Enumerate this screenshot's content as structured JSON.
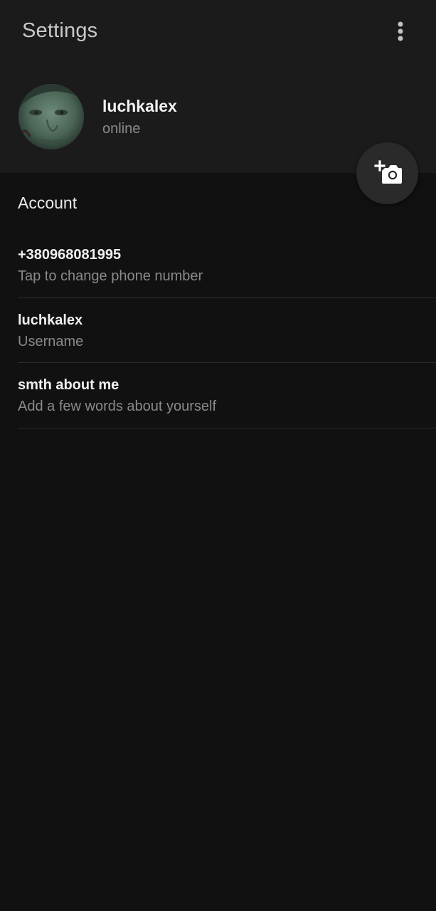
{
  "header": {
    "title": "Settings",
    "menu_icon": "more-vertical-icon"
  },
  "profile": {
    "name": "luchkalex",
    "status": "online",
    "avatar_icon": "avatar-photo",
    "fab_icon": "add-photo-camera-icon"
  },
  "account": {
    "section_title": "Account",
    "rows": [
      {
        "primary": "+380968081995",
        "secondary": "Tap to change phone number"
      },
      {
        "primary": "luchkalex",
        "secondary": "Username"
      },
      {
        "primary": "smth about me",
        "secondary": "Add a few words about yourself"
      }
    ]
  },
  "colors": {
    "background": "#111111",
    "header_background": "#1b1b1b",
    "fab_background": "#2a2a2a",
    "primary_text": "#f0f0f0",
    "secondary_text": "#8a8a8a"
  }
}
